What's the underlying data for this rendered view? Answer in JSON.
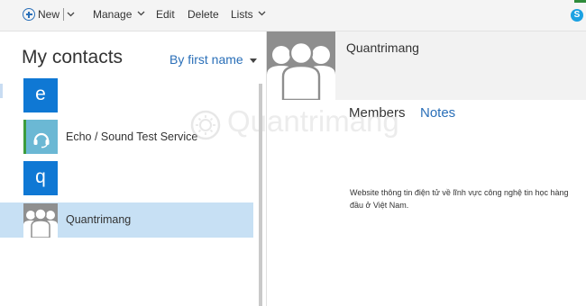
{
  "toolbar": {
    "new_label": "New",
    "manage_label": "Manage",
    "edit_label": "Edit",
    "delete_label": "Delete",
    "lists_label": "Lists",
    "skype_icon": "S"
  },
  "left_pane": {
    "title": "My contacts",
    "sort_label": "By first name",
    "contacts": [
      {
        "tile": "e",
        "name": "",
        "type": "letter-header"
      },
      {
        "tile": "",
        "name": "Echo / Sound Test Service",
        "type": "contact",
        "icon": "headset-icon"
      },
      {
        "tile": "q",
        "name": "",
        "type": "letter-header"
      },
      {
        "tile": "",
        "name": "Quantrimang",
        "type": "group",
        "icon": "group-icon",
        "selected": true
      }
    ]
  },
  "detail": {
    "name": "Quantrimang",
    "tabs": [
      {
        "label": "Members",
        "active": false
      },
      {
        "label": "Notes",
        "active": true
      }
    ],
    "notes": "Website thông tin điện tử về lĩnh vực công nghệ tin học hàng đầu ở Việt Nam."
  },
  "watermark": {
    "text": "Quantrimang"
  },
  "colors": {
    "accent": "#2a6fb8",
    "tile_blue": "#0f78d4",
    "selected_row": "#c7e0f4",
    "skype": "#1ba1e2",
    "group_avatar": "#8f8f8f"
  }
}
